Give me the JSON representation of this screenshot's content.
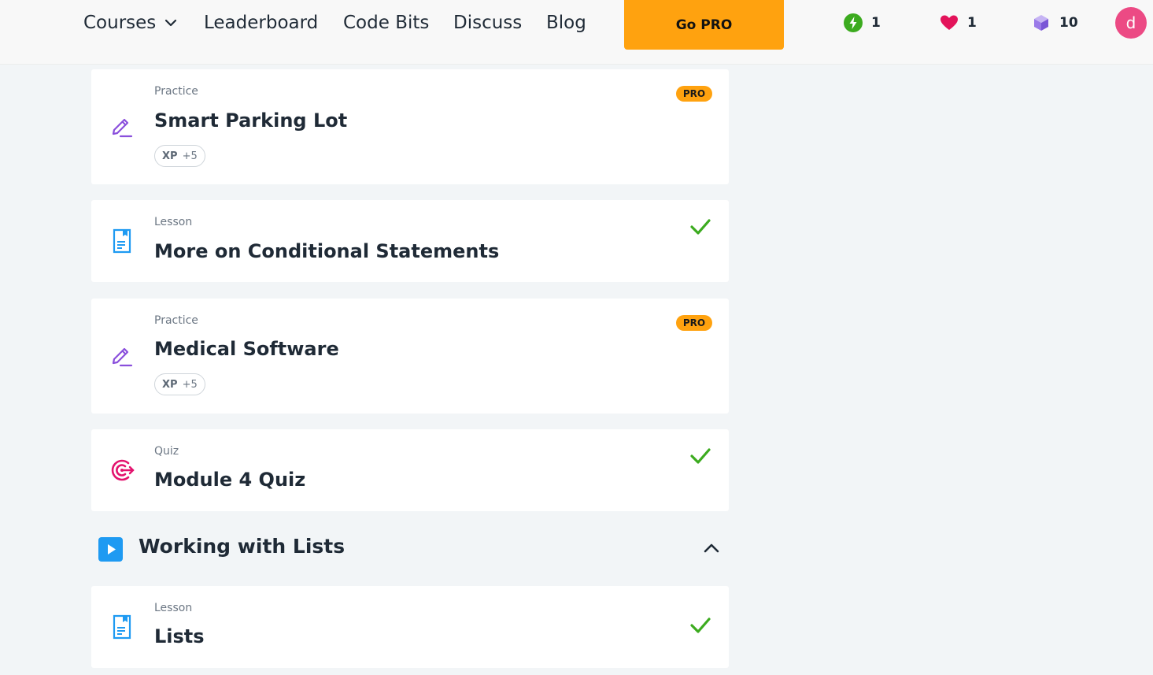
{
  "nav": {
    "courses": "Courses",
    "leaderboard": "Leaderboard",
    "code_bits": "Code Bits",
    "discuss": "Discuss",
    "blog": "Blog",
    "go_pro": "Go PRO"
  },
  "stats": {
    "streak": "1",
    "hearts": "1",
    "bits": "10"
  },
  "user": {
    "avatar_letter": "d"
  },
  "items": [
    {
      "kind": "Practice",
      "title": "Smart Parking Lot",
      "xp_label": "XP",
      "xp_value": "+5",
      "badge": "PRO"
    },
    {
      "kind": "Lesson",
      "title": "More on Conditional Statements"
    },
    {
      "kind": "Practice",
      "title": "Medical Software",
      "xp_label": "XP",
      "xp_value": "+5",
      "badge": "PRO"
    },
    {
      "kind": "Quiz",
      "title": "Module 4 Quiz"
    }
  ],
  "section": {
    "title": "Working with Lists"
  },
  "section_items": [
    {
      "kind": "Lesson",
      "title": "Lists"
    }
  ],
  "colors": {
    "pro": "#ffa20f",
    "practice_icon": "#8a4fdc",
    "lesson_icon": "#1e9af2",
    "quiz_icon": "#e3136e",
    "check": "#3cab1f",
    "streak": "#3cab1f",
    "heart": "#e3135a",
    "bits": "#9a7ae8"
  },
  "icons": {
    "practice": "pencil-icon",
    "lesson": "document-icon",
    "quiz": "target-icon",
    "completed": "check-icon",
    "section": "play-icon",
    "collapse": "chevron-up-icon"
  }
}
